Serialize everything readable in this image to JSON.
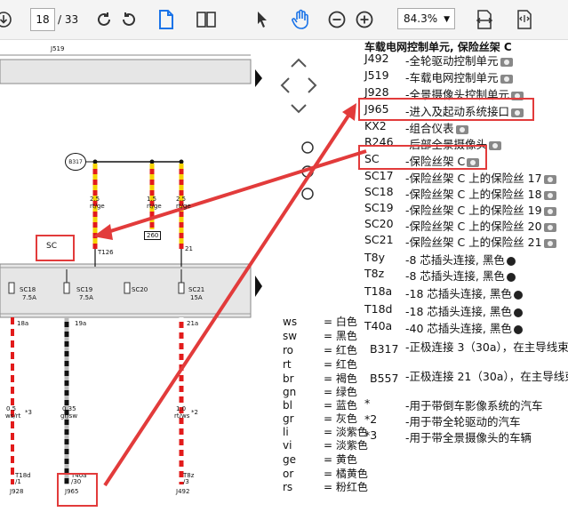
{
  "toolbar": {
    "page_current": "18",
    "page_total": "/ 33",
    "zoom": "84.3%",
    "icons": [
      "download-icon",
      "rotate-cw-icon",
      "rotate-ccw-icon",
      "document-icon",
      "two-page-icon",
      "pointer-icon",
      "hand-icon",
      "zoom-out-icon",
      "zoom-in-icon",
      "fit-width-icon",
      "fit-page-icon"
    ]
  },
  "schematic": {
    "top_label": "J519",
    "b317": "B317",
    "sc_label": "SC",
    "fuses": [
      {
        "name": "SC18",
        "amps": "7.5A"
      },
      {
        "name": "SC19",
        "amps": "7.5A"
      },
      {
        "name": "SC20",
        "amps": ""
      },
      {
        "name": "SC21",
        "amps": "15A"
      }
    ],
    "wire_labels_top": [
      {
        "size": "2.5",
        "color": "rt/ge"
      },
      {
        "size": "1.5",
        "color": "rt/ge"
      },
      {
        "size": "2.5",
        "color": "rt/ge"
      }
    ],
    "conn_260": "260",
    "conn_t126": "T126",
    "conn_21": "21",
    "pins_mid": [
      "18a",
      "19a",
      "21a"
    ],
    "wire_labels_bottom": [
      {
        "size": "0.5",
        "color": "ws/rt",
        "note": "*3"
      },
      {
        "size": "0.35",
        "color": "gr/sw",
        "note": ""
      },
      {
        "size": "1.0",
        "color": "rt/ws",
        "note": "*2"
      }
    ],
    "bottom_conns": [
      "T18d",
      "T40a",
      "T8z"
    ],
    "bottom_pins": [
      "/1",
      "/30",
      "/3"
    ],
    "bottom_parts": [
      "J928",
      "J965",
      "J492"
    ]
  },
  "color_legend": [
    {
      "code": "ws",
      "name": "= 白色"
    },
    {
      "code": "sw",
      "name": "= 黑色"
    },
    {
      "code": "ro",
      "name": "= 红色"
    },
    {
      "code": "rt",
      "name": "= 红色"
    },
    {
      "code": "br",
      "name": "= 褐色"
    },
    {
      "code": "gn",
      "name": "= 绿色"
    },
    {
      "code": "bl",
      "name": "= 蓝色"
    },
    {
      "code": "gr",
      "name": "= 灰色"
    },
    {
      "code": "li",
      "name": "= 淡紫色"
    },
    {
      "code": "vi",
      "name": "= 淡紫色"
    },
    {
      "code": "ge",
      "name": "= 黄色"
    },
    {
      "code": "or",
      "name": "= 橘黄色"
    },
    {
      "code": "rs",
      "name": "= 粉红色"
    }
  ],
  "component_table": {
    "header": "车载电网控制单元, 保险丝架 C",
    "rows": [
      {
        "code": "J492",
        "desc": "-全轮驱动控制单元",
        "icon": "camera-icon"
      },
      {
        "code": "J519",
        "desc": "-车载电网控制单元",
        "icon": "camera-icon"
      },
      {
        "code": "J928",
        "desc": "-全景摄像头控制单元",
        "icon": "camera-icon"
      },
      {
        "code": "J965",
        "desc": "-进入及起动系统接口",
        "icon": "camera-icon"
      },
      {
        "code": "KX2",
        "desc": "-组合仪表",
        "icon": "camera-icon"
      },
      {
        "code": "R246",
        "desc": "-后部全景摄像头",
        "icon": "camera-icon"
      },
      {
        "code": "SC",
        "desc": "-保险丝架 C",
        "icon": "camera-icon"
      },
      {
        "code": "SC17",
        "desc": "-保险丝架 C 上的保险丝 17",
        "icon": "camera-icon"
      },
      {
        "code": "SC18",
        "desc": "-保险丝架 C 上的保险丝 18",
        "icon": "camera-icon"
      },
      {
        "code": "SC19",
        "desc": "-保险丝架 C 上的保险丝 19",
        "icon": "camera-icon"
      },
      {
        "code": "SC20",
        "desc": "-保险丝架 C 上的保险丝 20",
        "icon": "camera-icon"
      },
      {
        "code": "SC21",
        "desc": "-保险丝架 C 上的保险丝 21",
        "icon": "camera-icon"
      },
      {
        "code": "T8y",
        "desc": "-8 芯插头连接, 黑色",
        "icon": "plug-icon"
      },
      {
        "code": "T8z",
        "desc": "-8 芯插头连接, 黑色",
        "icon": "plug-icon"
      },
      {
        "code": "T18a",
        "desc": "-18 芯插头连接, 黑色",
        "icon": "plug-icon"
      },
      {
        "code": "T18d",
        "desc": "-18 芯插头连接, 黑色",
        "icon": "plug-icon"
      },
      {
        "code": "T40a",
        "desc": "-40 芯插头连接, 黑色",
        "icon": "plug-icon"
      },
      {
        "code": "B317",
        "desc": "-正极连接 3（30a），在主导线束",
        "icon": ""
      },
      {
        "code": "B557",
        "desc": "-正极连接 21（30a），在主导线束",
        "icon": ""
      }
    ]
  },
  "footnotes": [
    {
      "mark": "*",
      "text": "-用于带倒车影像系统的汽车"
    },
    {
      "mark": "*2",
      "text": "-用于带全轮驱动的汽车"
    },
    {
      "mark": "*3",
      "text": "-用于带全景摄像头的车辆"
    }
  ],
  "accent_color": "#e23b3b"
}
